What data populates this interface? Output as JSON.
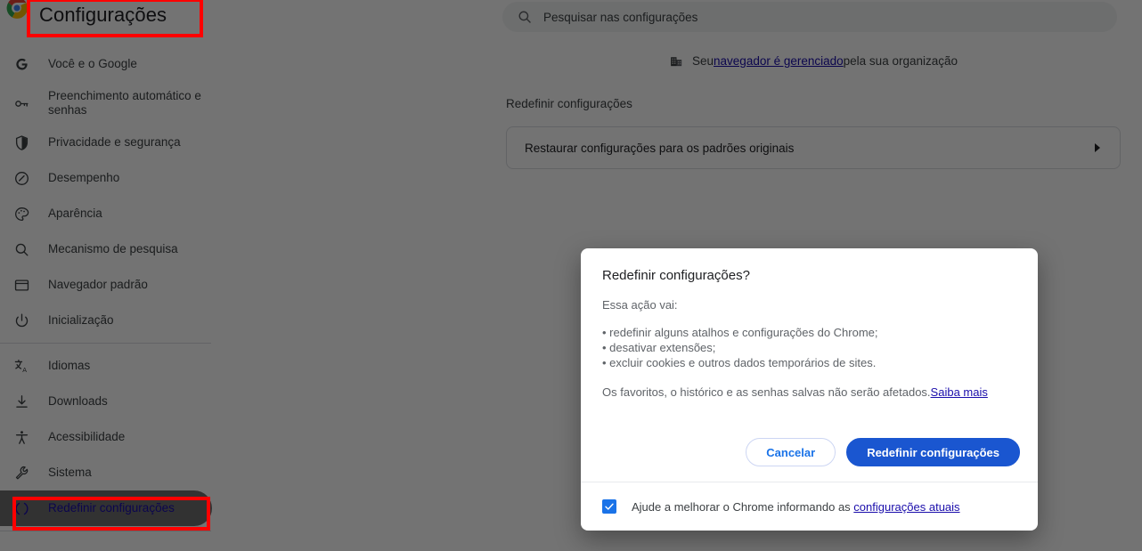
{
  "app": {
    "title": "Configurações",
    "logo_icon": "chrome-logo-icon"
  },
  "search": {
    "placeholder": "Pesquisar nas configurações",
    "value": "",
    "icon": "search-icon"
  },
  "sidebar": {
    "items": [
      {
        "label": "Você e o Google",
        "icon": "google-g-icon",
        "selected": false
      },
      {
        "label": "Preenchimento automático e senhas",
        "icon": "key-icon",
        "selected": false
      },
      {
        "label": "Privacidade e segurança",
        "icon": "shield-icon",
        "selected": false
      },
      {
        "label": "Desempenho",
        "icon": "speedometer-icon",
        "selected": false
      },
      {
        "label": "Aparência",
        "icon": "palette-icon",
        "selected": false
      },
      {
        "label": "Mecanismo de pesquisa",
        "icon": "search-icon",
        "selected": false
      },
      {
        "label": "Navegador padrão",
        "icon": "window-icon",
        "selected": false
      },
      {
        "label": "Inicialização",
        "icon": "power-icon",
        "selected": false
      },
      {
        "label": "Idiomas",
        "icon": "translate-icon",
        "selected": false
      },
      {
        "label": "Downloads",
        "icon": "download-icon",
        "selected": false
      },
      {
        "label": "Acessibilidade",
        "icon": "accessibility-icon",
        "selected": false
      },
      {
        "label": "Sistema",
        "icon": "wrench-icon",
        "selected": false
      },
      {
        "label": "Redefinir configurações",
        "icon": "reset-icon",
        "selected": true
      }
    ]
  },
  "main": {
    "managed_banner": {
      "icon": "business-building-icon",
      "prefix": "Seu ",
      "link": "navegador é gerenciado",
      "suffix": " pela sua organização"
    },
    "section_title": "Redefinir configurações",
    "card": {
      "label": "Restaurar configurações para os padrões originais",
      "arrow_icon": "chevron-right-icon"
    }
  },
  "dialog": {
    "title": "Redefinir configurações?",
    "lead": "Essa ação vai:",
    "bullets": [
      "• redefinir alguns atalhos e configurações do Chrome;",
      "• desativar extensões;",
      "• excluir cookies e outros dados temporários de sites."
    ],
    "footnote": "Os favoritos, o histórico e as senhas salvas não serão afetados.",
    "footnote_link": "Saiba mais",
    "cancel_label": "Cancelar",
    "confirm_label": "Redefinir configurações",
    "checkbox": {
      "checked": true,
      "text": "Ajude a melhorar o Chrome informando as ",
      "link": "configurações atuais"
    }
  },
  "colors": {
    "accent_blue": "#1a73e8",
    "primary_button": "#1a56d0",
    "link_blue": "#1a0dab",
    "annotation_red": "#ff0000",
    "scrim": "rgba(0,0,0,0.55)"
  },
  "annotations": [
    {
      "name": "highlight-page-title",
      "color": "#ff0000"
    },
    {
      "name": "highlight-reset-nav-item",
      "color": "#ff0000"
    }
  ]
}
